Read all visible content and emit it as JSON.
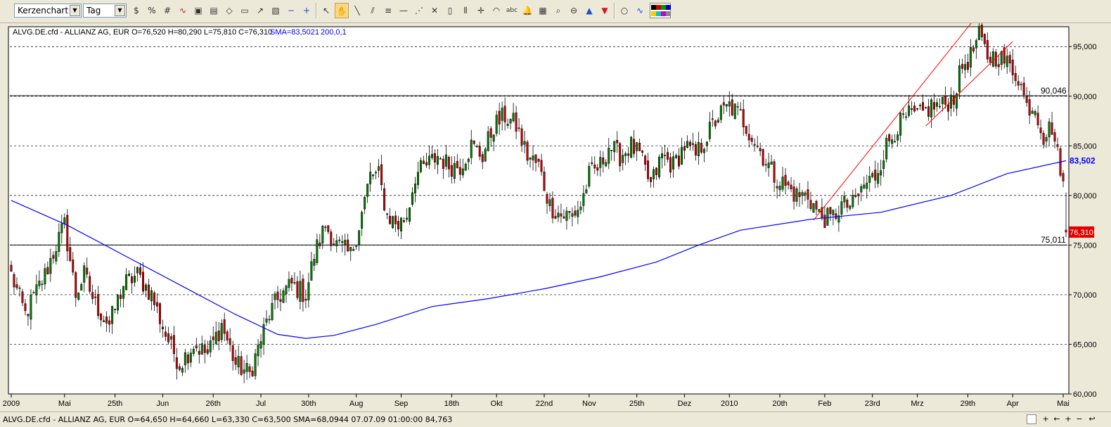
{
  "toolbar": {
    "chart_type": "Kerzenchart",
    "period": "Tag",
    "icons": [
      "currency-icon",
      "percent-icon",
      "grid-icon",
      "line-chart-icon",
      "save-icon",
      "picture-icon",
      "erase-icon",
      "print-icon",
      "export-icon",
      "image-icon",
      "minus-icon",
      "plus-icon",
      "cursor-icon",
      "hand-icon",
      "line-icon",
      "parallel-lines-icon",
      "fibonacci-icon",
      "horizontal-line-icon",
      "fan-icon",
      "cross-icon",
      "rectangle-icon",
      "vertical-lines-icon",
      "crosshair-icon",
      "arc-icon",
      "text-icon",
      "bell-icon",
      "calculator-icon",
      "zoom-icon",
      "zoom-out-icon",
      "up-arrow-icon",
      "down-arrow-icon",
      "circle-icon",
      "wave-icon"
    ]
  },
  "legend": {
    "instrument": "ALVG.DE.cfd - ALLIANZ AG, EUR O=76,520 H=80,290 L=75,810 C=76,310",
    "sma_label": "SMA=83,5021",
    "sma_params": "200,0,1"
  },
  "chart_data": {
    "type": "candlestick",
    "instrument": "ALVG.DE.cfd - ALLIANZ AG, EUR",
    "last_candle": {
      "open": 76.52,
      "high": 80.29,
      "low": 75.81,
      "close": 76.31
    },
    "ylim": [
      60,
      97
    ],
    "y_ticks": [
      "60,000",
      "65,000",
      "70,000",
      "75,000",
      "80,000",
      "85,000",
      "90,000",
      "95,000"
    ],
    "x_ticks": [
      {
        "label": "2009",
        "i": 0
      },
      {
        "label": "Mai",
        "i": 19
      },
      {
        "label": "25th",
        "i": 37
      },
      {
        "label": "Jun",
        "i": 54
      },
      {
        "label": "26th",
        "i": 72
      },
      {
        "label": "Jul",
        "i": 89
      },
      {
        "label": "30th",
        "i": 106
      },
      {
        "label": "Aug",
        "i": 123
      },
      {
        "label": "Sep",
        "i": 139
      },
      {
        "label": "18th",
        "i": 157
      },
      {
        "label": "Okt",
        "i": 173
      },
      {
        "label": "22nd",
        "i": 190
      },
      {
        "label": "Nov",
        "i": 206
      },
      {
        "label": "25th",
        "i": 223
      },
      {
        "label": "Dez",
        "i": 240
      },
      {
        "label": "2010",
        "i": 256
      },
      {
        "label": "20th",
        "i": 274
      },
      {
        "label": "Feb",
        "i": 290
      },
      {
        "label": "23rd",
        "i": 307
      },
      {
        "label": "Mrz",
        "i": 323
      },
      {
        "label": "29th",
        "i": 341
      },
      {
        "label": "Apr",
        "i": 357
      },
      {
        "label": "Mai",
        "i": 375
      }
    ],
    "horizontal_lines": [
      {
        "label": "90,046",
        "value": 90.046
      },
      {
        "label": "75,011",
        "value": 75.011
      }
    ],
    "sma": {
      "name": "SMA",
      "period": 200,
      "current": "83,502",
      "color": "#0000ff",
      "values": [
        {
          "i": 0,
          "v": 79.5
        },
        {
          "i": 20,
          "v": 77.0
        },
        {
          "i": 40,
          "v": 74.0
        },
        {
          "i": 60,
          "v": 71.0
        },
        {
          "i": 80,
          "v": 68.0
        },
        {
          "i": 95,
          "v": 66.0
        },
        {
          "i": 105,
          "v": 65.6
        },
        {
          "i": 115,
          "v": 65.9
        },
        {
          "i": 130,
          "v": 67.0
        },
        {
          "i": 150,
          "v": 68.8
        },
        {
          "i": 170,
          "v": 69.6
        },
        {
          "i": 190,
          "v": 70.6
        },
        {
          "i": 210,
          "v": 71.8
        },
        {
          "i": 230,
          "v": 73.3
        },
        {
          "i": 245,
          "v": 75.0
        },
        {
          "i": 260,
          "v": 76.5
        },
        {
          "i": 285,
          "v": 77.6
        },
        {
          "i": 310,
          "v": 78.3
        },
        {
          "i": 335,
          "v": 80.0
        },
        {
          "i": 355,
          "v": 82.2
        },
        {
          "i": 376,
          "v": 83.5
        }
      ]
    },
    "trendlines": [
      {
        "color": "#ff0000",
        "from": {
          "i": 286,
          "v": 77.5
        },
        "to": {
          "i": 344,
          "v": 98.0
        }
      },
      {
        "color": "#ff0000",
        "from": {
          "i": 326,
          "v": 87.0
        },
        "to": {
          "i": 357,
          "v": 95.5
        }
      }
    ],
    "price_badge": {
      "text": "76,310",
      "value": 76.31
    },
    "anchors": [
      {
        "i": 0,
        "v": 72
      },
      {
        "i": 5,
        "v": 68
      },
      {
        "i": 12,
        "v": 72
      },
      {
        "i": 16,
        "v": 75
      },
      {
        "i": 19,
        "v": 77
      },
      {
        "i": 23,
        "v": 70
      },
      {
        "i": 26,
        "v": 72
      },
      {
        "i": 30,
        "v": 69
      },
      {
        "i": 35,
        "v": 67
      },
      {
        "i": 40,
        "v": 71
      },
      {
        "i": 45,
        "v": 72
      },
      {
        "i": 50,
        "v": 70
      },
      {
        "i": 55,
        "v": 66
      },
      {
        "i": 60,
        "v": 63
      },
      {
        "i": 65,
        "v": 65
      },
      {
        "i": 70,
        "v": 64
      },
      {
        "i": 75,
        "v": 67
      },
      {
        "i": 80,
        "v": 63
      },
      {
        "i": 85,
        "v": 62
      },
      {
        "i": 89,
        "v": 65.5
      },
      {
        "i": 92,
        "v": 68
      },
      {
        "i": 96,
        "v": 70
      },
      {
        "i": 100,
        "v": 71
      },
      {
        "i": 105,
        "v": 70
      },
      {
        "i": 108,
        "v": 74
      },
      {
        "i": 112,
        "v": 77
      },
      {
        "i": 116,
        "v": 75
      },
      {
        "i": 121,
        "v": 74
      },
      {
        "i": 124,
        "v": 77
      },
      {
        "i": 128,
        "v": 82
      },
      {
        "i": 131,
        "v": 82
      },
      {
        "i": 134,
        "v": 78
      },
      {
        "i": 138,
        "v": 77
      },
      {
        "i": 141,
        "v": 78
      },
      {
        "i": 144,
        "v": 82
      },
      {
        "i": 148,
        "v": 83
      },
      {
        "i": 152,
        "v": 84
      },
      {
        "i": 156,
        "v": 83
      },
      {
        "i": 160,
        "v": 83
      },
      {
        "i": 164,
        "v": 85
      },
      {
        "i": 168,
        "v": 84
      },
      {
        "i": 172,
        "v": 87
      },
      {
        "i": 176,
        "v": 88
      },
      {
        "i": 180,
        "v": 87
      },
      {
        "i": 184,
        "v": 84
      },
      {
        "i": 188,
        "v": 83
      },
      {
        "i": 192,
        "v": 79
      },
      {
        "i": 196,
        "v": 78
      },
      {
        "i": 200,
        "v": 78
      },
      {
        "i": 203,
        "v": 79
      },
      {
        "i": 206,
        "v": 82
      },
      {
        "i": 210,
        "v": 83
      },
      {
        "i": 213,
        "v": 85
      },
      {
        "i": 217,
        "v": 84
      },
      {
        "i": 221,
        "v": 85
      },
      {
        "i": 224,
        "v": 84
      },
      {
        "i": 228,
        "v": 81
      },
      {
        "i": 232,
        "v": 84
      },
      {
        "i": 236,
        "v": 83
      },
      {
        "i": 240,
        "v": 85
      },
      {
        "i": 244,
        "v": 84
      },
      {
        "i": 248,
        "v": 86
      },
      {
        "i": 252,
        "v": 88
      },
      {
        "i": 256,
        "v": 89
      },
      {
        "i": 260,
        "v": 88
      },
      {
        "i": 264,
        "v": 86
      },
      {
        "i": 268,
        "v": 84
      },
      {
        "i": 272,
        "v": 82
      },
      {
        "i": 276,
        "v": 81
      },
      {
        "i": 280,
        "v": 80
      },
      {
        "i": 284,
        "v": 80
      },
      {
        "i": 288,
        "v": 78
      },
      {
        "i": 292,
        "v": 77.5
      },
      {
        "i": 296,
        "v": 79
      },
      {
        "i": 300,
        "v": 79
      },
      {
        "i": 304,
        "v": 81
      },
      {
        "i": 308,
        "v": 82
      },
      {
        "i": 312,
        "v": 85
      },
      {
        "i": 316,
        "v": 87
      },
      {
        "i": 320,
        "v": 88
      },
      {
        "i": 324,
        "v": 88
      },
      {
        "i": 328,
        "v": 89
      },
      {
        "i": 332,
        "v": 89
      },
      {
        "i": 336,
        "v": 90
      },
      {
        "i": 339,
        "v": 93
      },
      {
        "i": 342,
        "v": 94
      },
      {
        "i": 345,
        "v": 96
      },
      {
        "i": 348,
        "v": 94
      },
      {
        "i": 352,
        "v": 94
      },
      {
        "i": 356,
        "v": 93
      },
      {
        "i": 359,
        "v": 92
      },
      {
        "i": 362,
        "v": 89
      },
      {
        "i": 365,
        "v": 89
      },
      {
        "i": 368,
        "v": 86
      },
      {
        "i": 371,
        "v": 87
      },
      {
        "i": 373,
        "v": 84
      },
      {
        "i": 374,
        "v": 83
      },
      {
        "i": 376,
        "v": 79
      }
    ]
  },
  "status": {
    "text": "ALVG.DE.cfd - ALLIANZ AG, EUR O=64,650 H=64,660 L=63,330 C=63,500  SMA=68,0944  07.07.09 01:00:00 84,763"
  },
  "statusbar_controls": {
    "plus": "+",
    "minus": "−",
    "back": "↩"
  },
  "colors": {
    "bull": "#008000",
    "bear": "#cc0000",
    "sma": "#0000ff",
    "trend": "#ff0000",
    "badge": "#e00000",
    "toolbar": "#ece9d8",
    "chart_bg": "#ffffff"
  }
}
